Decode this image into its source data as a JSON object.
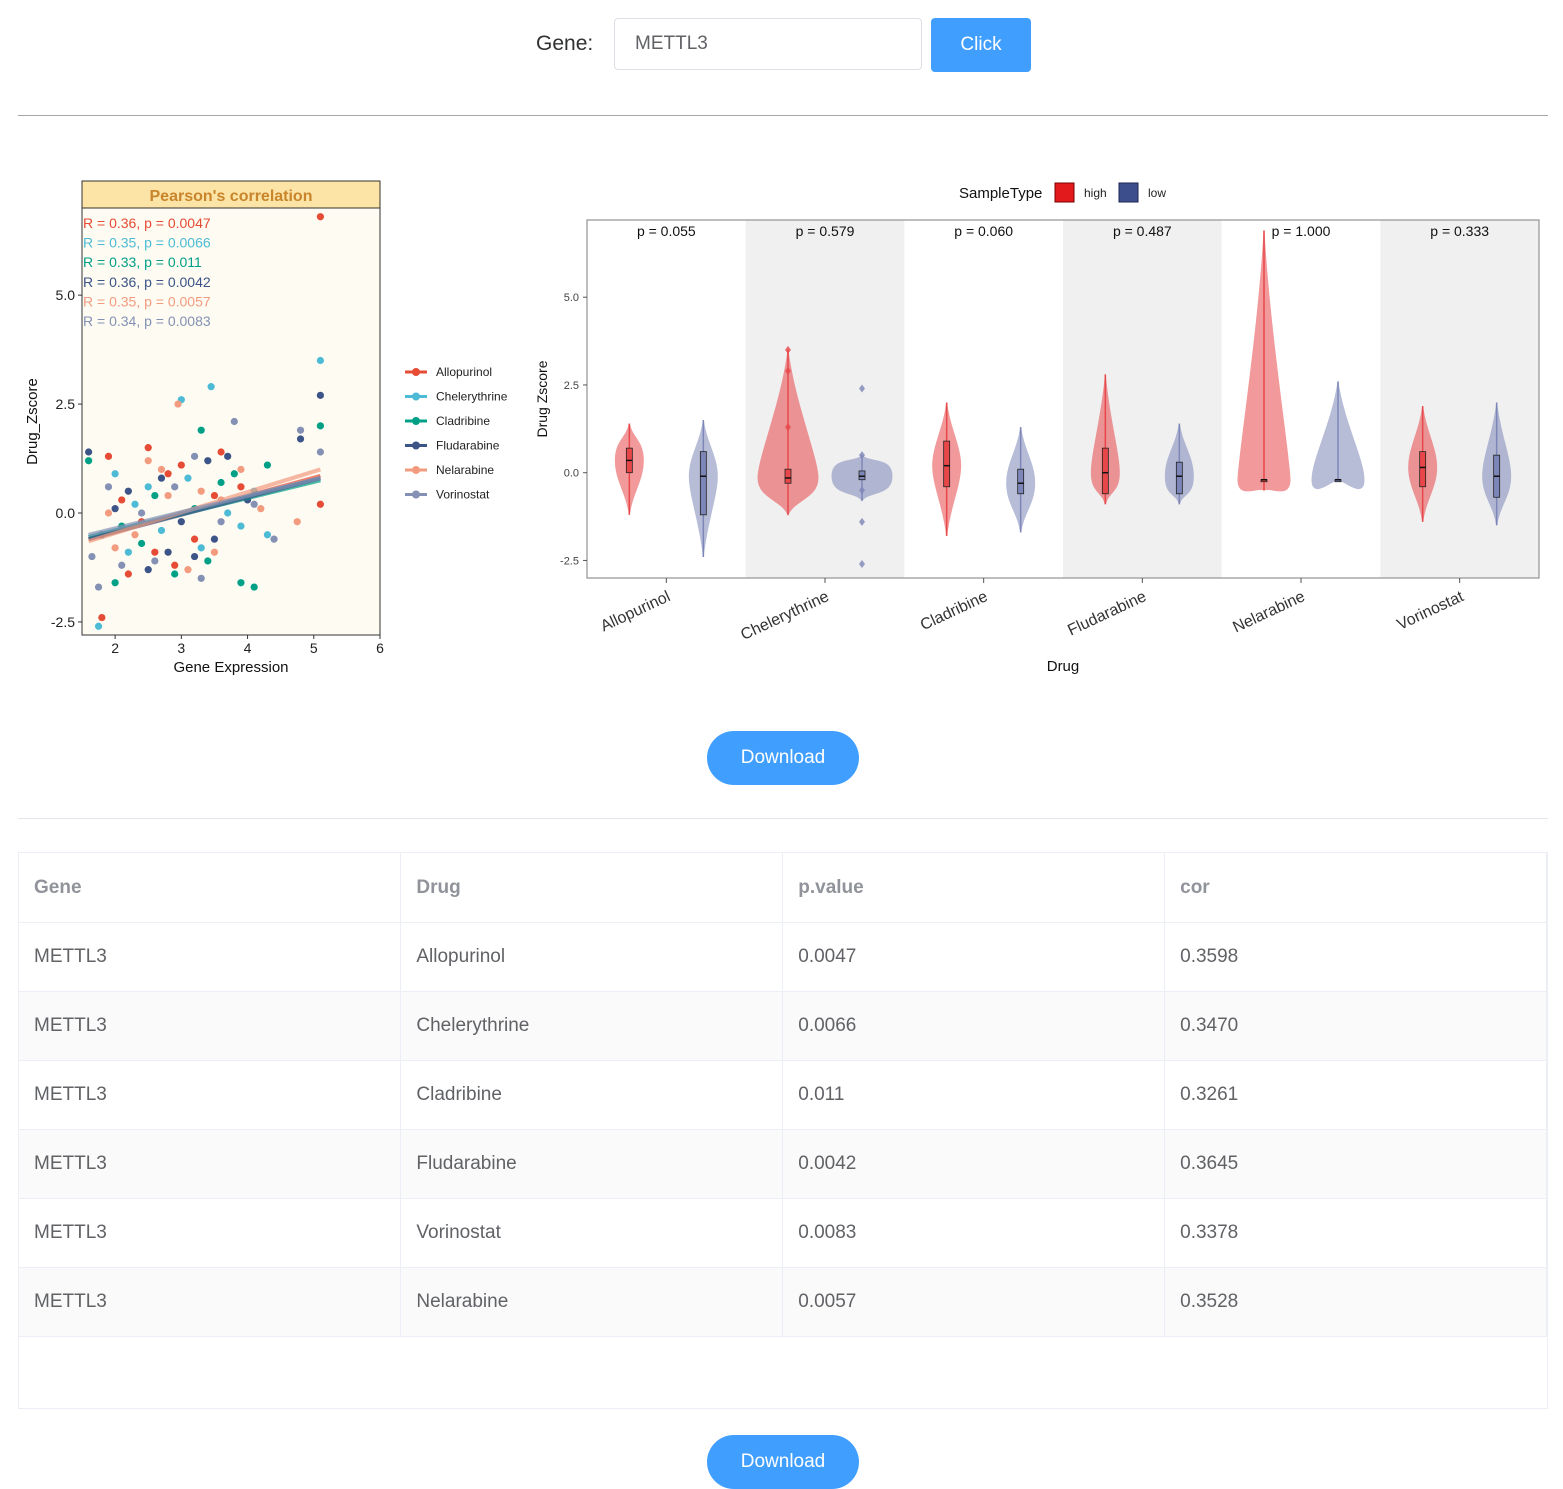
{
  "search": {
    "label": "Gene:",
    "value": "METTL3",
    "button": "Click"
  },
  "colors": {
    "Allopurinol": "#e64b35",
    "Chelerythrine": "#4dbbd5",
    "Cladribine": "#00a087",
    "Fludarabine": "#3c5488",
    "Nelarabine": "#f39b7f",
    "Vorinostat": "#8491b4",
    "high": "#e31a1c",
    "low": "#3c4e8c",
    "accent": "#409eff"
  },
  "chart_data": [
    {
      "type": "scatter",
      "title": "Pearson's correlation",
      "xlabel": "Gene Expression",
      "ylabel": "Drug_Zscore",
      "xlim": [
        1.5,
        6
      ],
      "ylim": [
        -2.8,
        7
      ],
      "xticks": [
        "2",
        "3",
        "4",
        "5",
        "6"
      ],
      "yticks": [
        "-2.5",
        "0.0",
        "2.5",
        "5.0"
      ],
      "legend_position": "right",
      "annotations": [
        {
          "r": "R = 0.36,",
          "p": "p = 0.0047",
          "series": "Allopurinol"
        },
        {
          "r": "R = 0.35,",
          "p": "p = 0.0066",
          "series": "Chelerythrine"
        },
        {
          "r": "R = 0.33,",
          "p": "p = 0.011",
          "series": "Cladribine"
        },
        {
          "r": "R = 0.36,",
          "p": "p = 0.0042",
          "series": "Fludarabine"
        },
        {
          "r": "R = 0.35,",
          "p": "p = 0.0057",
          "series": "Nelarabine"
        },
        {
          "r": "R = 0.34,",
          "p": "p = 0.0083",
          "series": "Vorinostat"
        }
      ],
      "series": [
        {
          "name": "Allopurinol",
          "points": [
            [
              1.8,
              -2.4
            ],
            [
              5.1,
              6.8
            ],
            [
              5.1,
              0.2
            ],
            [
              2.5,
              1.5
            ],
            [
              2.8,
              0.9
            ],
            [
              3.2,
              -0.6
            ],
            [
              2.2,
              -1.4
            ],
            [
              3.5,
              0.4
            ],
            [
              2.9,
              -1.2
            ],
            [
              1.9,
              1.3
            ],
            [
              3.9,
              0.6
            ],
            [
              2.4,
              -0.2
            ],
            [
              3.0,
              1.1
            ],
            [
              2.6,
              -0.9
            ],
            [
              3.6,
              1.4
            ],
            [
              2.1,
              0.3
            ]
          ]
        },
        {
          "name": "Chelerythrine",
          "points": [
            [
              1.75,
              -2.6
            ],
            [
              5.1,
              3.5
            ],
            [
              3.0,
              2.6
            ],
            [
              3.45,
              2.9
            ],
            [
              2.3,
              0.2
            ],
            [
              2.7,
              -0.4
            ],
            [
              3.1,
              0.8
            ],
            [
              3.9,
              -0.3
            ],
            [
              4.1,
              0.5
            ],
            [
              2.0,
              0.9
            ],
            [
              3.3,
              -0.8
            ],
            [
              2.5,
              0.6
            ],
            [
              3.7,
              0.0
            ],
            [
              4.3,
              -0.5
            ],
            [
              2.2,
              -0.9
            ]
          ]
        },
        {
          "name": "Cladribine",
          "points": [
            [
              5.1,
              2.0
            ],
            [
              3.3,
              1.9
            ],
            [
              3.9,
              -1.6
            ],
            [
              4.1,
              -1.7
            ],
            [
              1.6,
              1.2
            ],
            [
              2.4,
              -0.7
            ],
            [
              2.9,
              -1.4
            ],
            [
              3.6,
              0.7
            ],
            [
              2.1,
              -0.3
            ],
            [
              3.2,
              0.1
            ],
            [
              4.3,
              1.1
            ],
            [
              2.6,
              0.4
            ],
            [
              3.4,
              -1.1
            ],
            [
              2.0,
              -1.6
            ],
            [
              3.8,
              0.9
            ]
          ]
        },
        {
          "name": "Fludarabine",
          "points": [
            [
              5.1,
              2.7
            ],
            [
              4.8,
              1.7
            ],
            [
              1.6,
              1.4
            ],
            [
              2.8,
              -0.9
            ],
            [
              3.4,
              1.2
            ],
            [
              2.2,
              0.5
            ],
            [
              3.0,
              -0.2
            ],
            [
              3.7,
              1.3
            ],
            [
              2.5,
              -1.3
            ],
            [
              3.5,
              -0.6
            ],
            [
              2.0,
              0.1
            ],
            [
              4.0,
              0.3
            ],
            [
              2.7,
              0.8
            ],
            [
              3.2,
              -1.0
            ],
            [
              1.8,
              -0.5
            ]
          ]
        },
        {
          "name": "Nelarabine",
          "points": [
            [
              2.95,
              2.5
            ],
            [
              4.75,
              -0.2
            ],
            [
              3.6,
              0.3
            ],
            [
              2.3,
              -0.5
            ],
            [
              2.7,
              1.0
            ],
            [
              3.1,
              -1.3
            ],
            [
              3.9,
              1.0
            ],
            [
              2.0,
              -0.8
            ],
            [
              3.3,
              0.5
            ],
            [
              2.5,
              1.2
            ],
            [
              4.2,
              0.1
            ],
            [
              1.9,
              0.0
            ],
            [
              3.5,
              -0.9
            ],
            [
              2.8,
              0.4
            ]
          ]
        },
        {
          "name": "Vorinostat",
          "points": [
            [
              5.1,
              1.4
            ],
            [
              4.8,
              1.9
            ],
            [
              3.8,
              2.1
            ],
            [
              1.75,
              -1.7
            ],
            [
              1.65,
              -1.0
            ],
            [
              3.3,
              -1.5
            ],
            [
              2.4,
              0.0
            ],
            [
              2.9,
              0.6
            ],
            [
              3.6,
              -0.2
            ],
            [
              2.1,
              -1.2
            ],
            [
              4.1,
              0.2
            ],
            [
              2.6,
              -1.1
            ],
            [
              3.2,
              1.3
            ],
            [
              1.9,
              0.6
            ],
            [
              4.4,
              -0.6
            ]
          ]
        }
      ],
      "trend_lines": [
        {
          "series": "Allopurinol",
          "x": [
            1.6,
            5.1
          ],
          "y": [
            -0.6,
            0.85
          ]
        },
        {
          "series": "Chelerythrine",
          "x": [
            1.6,
            5.1
          ],
          "y": [
            -0.55,
            0.8
          ]
        },
        {
          "series": "Cladribine",
          "x": [
            1.6,
            5.1
          ],
          "y": [
            -0.55,
            0.75
          ]
        },
        {
          "series": "Fludarabine",
          "x": [
            1.6,
            5.1
          ],
          "y": [
            -0.6,
            0.8
          ]
        },
        {
          "series": "Nelarabine",
          "x": [
            1.6,
            5.1
          ],
          "y": [
            -0.65,
            1.0
          ]
        },
        {
          "series": "Vorinostat",
          "x": [
            1.6,
            5.1
          ],
          "y": [
            -0.5,
            0.8
          ]
        }
      ]
    },
    {
      "type": "violin",
      "legend_title": "SampleType",
      "legend_labels": [
        "high",
        "low"
      ],
      "legend_position": "top",
      "xlabel": "Drug",
      "ylabel": "Drug Zscore",
      "ylim": [
        -3,
        7.2
      ],
      "yticks": [
        "-2.5",
        "0.0",
        "2.5",
        "5.0"
      ],
      "categories": [
        "Allopurinol",
        "Chelerythrine",
        "Cladribine",
        "Fludarabine",
        "Nelarabine",
        "Vorinostat"
      ],
      "p_values": [
        "p = 0.055",
        "p = 0.579",
        "p = 0.060",
        "p = 0.487",
        "p = 1.000",
        "p = 0.333"
      ],
      "groups": [
        {
          "high": {
            "min": -1.2,
            "max": 1.4,
            "q1": 0.0,
            "median": 0.35,
            "q3": 0.7
          },
          "low": {
            "min": -2.4,
            "max": 1.5,
            "q1": -1.2,
            "median": -0.1,
            "q3": 0.6
          }
        },
        {
          "high": {
            "min": -1.2,
            "max": 3.5,
            "q1": -0.3,
            "median": -0.15,
            "q3": 0.1,
            "outliers": [
              3.5,
              2.9,
              1.3
            ]
          },
          "low": {
            "min": -0.8,
            "max": 0.5,
            "q1": -0.2,
            "median": -0.1,
            "q3": 0.05,
            "outliers": [
              2.4,
              -1.4,
              -2.6,
              0.5,
              -0.5
            ]
          }
        },
        {
          "high": {
            "min": -1.8,
            "max": 2.0,
            "q1": -0.4,
            "median": 0.2,
            "q3": 0.9
          },
          "low": {
            "min": -1.7,
            "max": 1.3,
            "q1": -0.6,
            "median": -0.3,
            "q3": 0.1
          }
        },
        {
          "high": {
            "min": -0.9,
            "max": 2.8,
            "q1": -0.6,
            "median": 0.0,
            "q3": 0.7
          },
          "low": {
            "min": -0.9,
            "max": 1.4,
            "q1": -0.6,
            "median": -0.1,
            "q3": 0.3
          }
        },
        {
          "high": {
            "min": -0.5,
            "max": 6.9,
            "q1": -0.2,
            "median": -0.2,
            "q3": -0.2
          },
          "low": {
            "min": -0.2,
            "max": 2.6,
            "q1": -0.2,
            "median": -0.2,
            "q3": -0.2
          }
        },
        {
          "high": {
            "min": -1.4,
            "max": 1.9,
            "q1": -0.4,
            "median": 0.15,
            "q3": 0.6
          },
          "low": {
            "min": -1.5,
            "max": 2.0,
            "q1": -0.7,
            "median": -0.1,
            "q3": 0.5
          }
        }
      ]
    }
  ],
  "download_label": "Download",
  "table": {
    "columns": [
      "Gene",
      "Drug",
      "p.value",
      "cor"
    ],
    "rows": [
      [
        "METTL3",
        "Allopurinol",
        "0.0047",
        "0.3598"
      ],
      [
        "METTL3",
        "Chelerythrine",
        "0.0066",
        "0.3470"
      ],
      [
        "METTL3",
        "Cladribine",
        "0.011",
        "0.3261"
      ],
      [
        "METTL3",
        "Fludarabine",
        "0.0042",
        "0.3645"
      ],
      [
        "METTL3",
        "Vorinostat",
        "0.0083",
        "0.3378"
      ],
      [
        "METTL3",
        "Nelarabine",
        "0.0057",
        "0.3528"
      ]
    ]
  }
}
